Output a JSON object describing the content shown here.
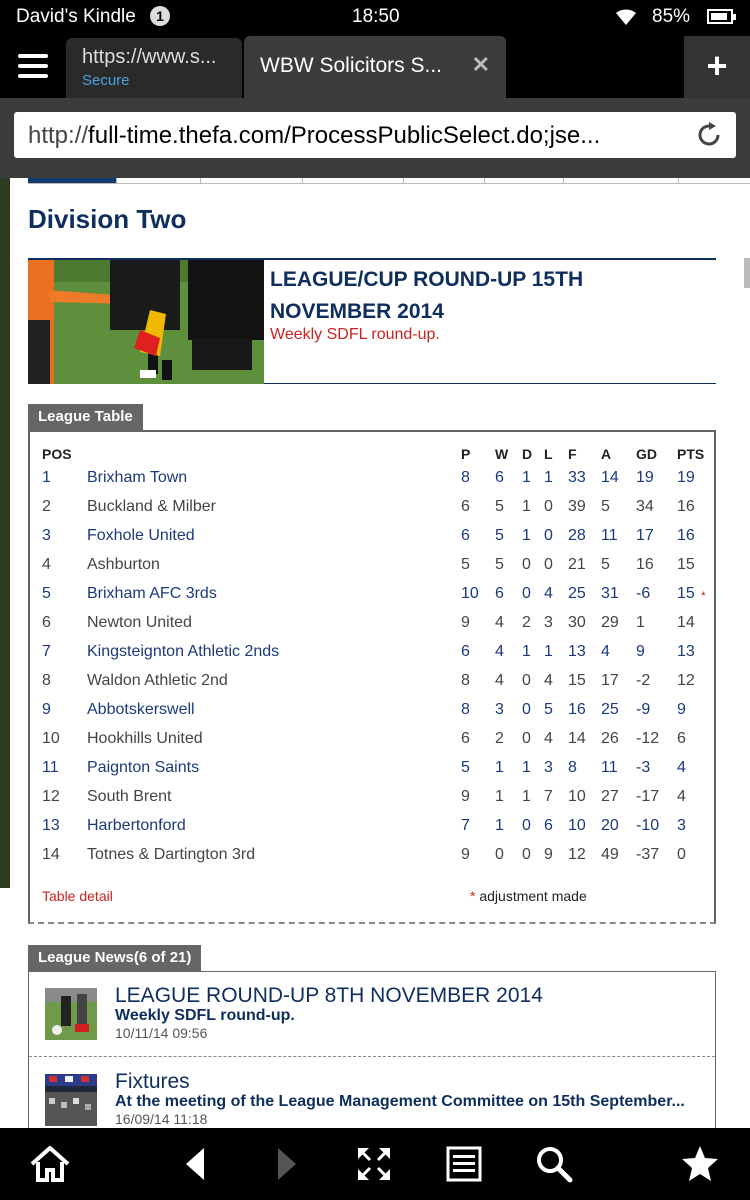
{
  "status": {
    "device_name": "David's Kindle",
    "notification_count": "1",
    "time": "18:50",
    "battery": "85%"
  },
  "tabs": [
    {
      "url": "https://www.s...",
      "security": "Secure"
    },
    {
      "title": "WBW Solicitors S..."
    }
  ],
  "address_bar": {
    "prefix": "http://",
    "url": "full-time.thefa.com/ProcessPublicSelect.do;jse..."
  },
  "page": {
    "division_title": "Division Two",
    "article": {
      "headline": "LEAGUE/CUP ROUND-UP 15TH NOVEMBER 2014",
      "summary": "Weekly SDFL round-up."
    },
    "league_table": {
      "tab_label": "League Table",
      "headers": {
        "pos": "POS",
        "p": "P",
        "w": "W",
        "d": "D",
        "l": "L",
        "f": "F",
        "a": "A",
        "gd": "GD",
        "pts": "PTS"
      },
      "rows": [
        {
          "pos": "1",
          "team": "Brixham Town",
          "p": "8",
          "w": "6",
          "d": "1",
          "l": "1",
          "f": "33",
          "a": "14",
          "gd": "19",
          "pts": "19",
          "adj": ""
        },
        {
          "pos": "2",
          "team": "Buckland & Milber",
          "p": "6",
          "w": "5",
          "d": "1",
          "l": "0",
          "f": "39",
          "a": "5",
          "gd": "34",
          "pts": "16",
          "adj": ""
        },
        {
          "pos": "3",
          "team": "Foxhole United",
          "p": "6",
          "w": "5",
          "d": "1",
          "l": "0",
          "f": "28",
          "a": "11",
          "gd": "17",
          "pts": "16",
          "adj": ""
        },
        {
          "pos": "4",
          "team": "Ashburton",
          "p": "5",
          "w": "5",
          "d": "0",
          "l": "0",
          "f": "21",
          "a": "5",
          "gd": "16",
          "pts": "15",
          "adj": ""
        },
        {
          "pos": "5",
          "team": "Brixham AFC 3rds",
          "p": "10",
          "w": "6",
          "d": "0",
          "l": "4",
          "f": "25",
          "a": "31",
          "gd": "-6",
          "pts": "15",
          "adj": "*"
        },
        {
          "pos": "6",
          "team": "Newton United",
          "p": "9",
          "w": "4",
          "d": "2",
          "l": "3",
          "f": "30",
          "a": "29",
          "gd": "1",
          "pts": "14",
          "adj": ""
        },
        {
          "pos": "7",
          "team": "Kingsteignton Athletic 2nds",
          "p": "6",
          "w": "4",
          "d": "1",
          "l": "1",
          "f": "13",
          "a": "4",
          "gd": "9",
          "pts": "13",
          "adj": ""
        },
        {
          "pos": "8",
          "team": "Waldon Athletic 2nd",
          "p": "8",
          "w": "4",
          "d": "0",
          "l": "4",
          "f": "15",
          "a": "17",
          "gd": "-2",
          "pts": "12",
          "adj": ""
        },
        {
          "pos": "9",
          "team": "Abbotskerswell",
          "p": "8",
          "w": "3",
          "d": "0",
          "l": "5",
          "f": "16",
          "a": "25",
          "gd": "-9",
          "pts": "9",
          "adj": ""
        },
        {
          "pos": "10",
          "team": "Hookhills United",
          "p": "6",
          "w": "2",
          "d": "0",
          "l": "4",
          "f": "14",
          "a": "26",
          "gd": "-12",
          "pts": "6",
          "adj": ""
        },
        {
          "pos": "11",
          "team": "Paignton Saints",
          "p": "5",
          "w": "1",
          "d": "1",
          "l": "3",
          "f": "8",
          "a": "11",
          "gd": "-3",
          "pts": "4",
          "adj": ""
        },
        {
          "pos": "12",
          "team": "South Brent",
          "p": "9",
          "w": "1",
          "d": "1",
          "l": "7",
          "f": "10",
          "a": "27",
          "gd": "-17",
          "pts": "4",
          "adj": ""
        },
        {
          "pos": "13",
          "team": "Harbertonford",
          "p": "7",
          "w": "1",
          "d": "0",
          "l": "6",
          "f": "10",
          "a": "20",
          "gd": "-10",
          "pts": "3",
          "adj": ""
        },
        {
          "pos": "14",
          "team": "Totnes & Dartington 3rd",
          "p": "9",
          "w": "0",
          "d": "0",
          "l": "9",
          "f": "12",
          "a": "49",
          "gd": "-37",
          "pts": "0",
          "adj": ""
        }
      ],
      "detail_link": "Table detail",
      "adjustment_star": "*",
      "adjustment_note": "adjustment made"
    },
    "league_news": {
      "tab_label": "League News(6 of 21)",
      "items": [
        {
          "title": "LEAGUE ROUND-UP 8TH NOVEMBER 2014",
          "summary": "Weekly SDFL round-up.",
          "date": "10/11/14 09:56"
        },
        {
          "title": "Fixtures",
          "summary": "At the meeting of the League Management Committee on 15th September...",
          "date": "16/09/14 11:18"
        }
      ]
    }
  },
  "bottom_nav": [
    "home-icon",
    "back-icon",
    "forward-icon",
    "fullscreen-icon",
    "reading-view-icon",
    "search-icon",
    "favorites-icon"
  ]
}
